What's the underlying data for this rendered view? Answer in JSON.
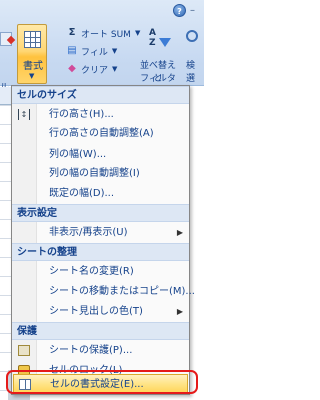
{
  "ribbon": {
    "left_label": "ル",
    "format_button": "書式",
    "autosum": "オート SUM",
    "fill": "フィル",
    "clear": "クリア",
    "sort_filter_line1": "並べ替えと",
    "sort_filter_line2": "フィルタ",
    "find_line1": "検",
    "find_line2": "選"
  },
  "menu": {
    "cell_size_header": "セルのサイズ",
    "row_height": "行の高さ(H)...",
    "row_autofit": "行の高さの自動調整(A)",
    "col_width": "列の幅(W)...",
    "col_autofit": "列の幅の自動調整(I)",
    "default_width": "既定の幅(D)...",
    "visibility_header": "表示設定",
    "hide_unhide": "非表示/再表示(U)",
    "organize_header": "シートの整理",
    "rename_sheet": "シート名の変更(R)",
    "move_copy_sheet": "シートの移動またはコピー(M)...",
    "tab_color": "シート見出しの色(T)",
    "protection_header": "保護",
    "protect_sheet": "シートの保護(P)...",
    "lock_cell": "セルのロック(L)",
    "format_cells": "セルの書式設定(E)..."
  },
  "colors": {
    "menu_text": "#15428b",
    "highlight": "#ffd65c",
    "callout": "#e51a1a"
  }
}
